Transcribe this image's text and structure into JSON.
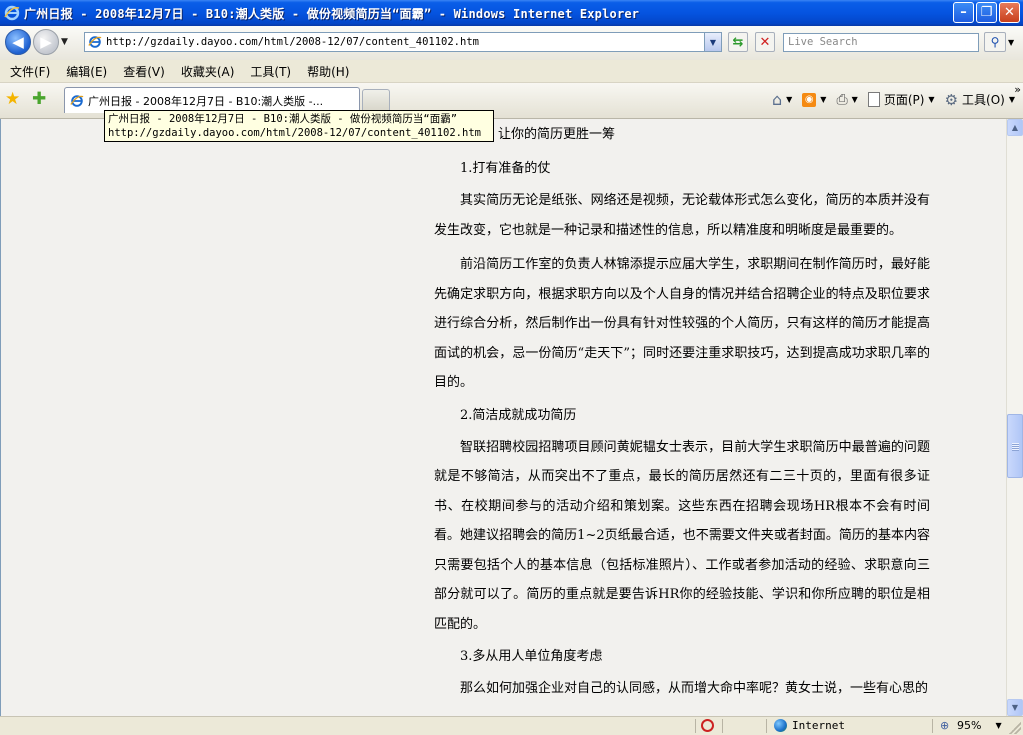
{
  "window": {
    "title": "广州日报 - 2008年12月7日 - B10:潮人类版 - 做份视频简历当“面霸” - Windows Internet Explorer"
  },
  "addressbar": {
    "url": "http://gzdaily.dayoo.com/html/2008-12/07/content_401102.htm",
    "search_placeholder": "Live Search"
  },
  "menu": {
    "items": [
      "文件(F)",
      "编辑(E)",
      "查看(V)",
      "收藏夹(A)",
      "工具(T)",
      "帮助(H)"
    ]
  },
  "tabs": {
    "active_label": "广州日报 - 2008年12月7日 - B10:潮人类版 -..."
  },
  "commandbar": {
    "page_label": "页面(P)",
    "tools_label": "工具(O)"
  },
  "tooltip": {
    "line1": "广州日报 - 2008年12月7日 - B10:潮人类版 - 做份视频简历当“面霸”",
    "line2": "http://gzdaily.dayoo.com/html/2008-12/07/content_401102.htm"
  },
  "article": {
    "intro": "让你的简历更胜一筹",
    "h1": "1.打有准备的仗",
    "p1": "其实简历无论是纸张、网络还是视频，无论载体形式怎么变化，简历的本质并没有发生改变，它也就是一种记录和描述性的信息，所以精准度和明晰度是最重要的。",
    "p2": "前沿简历工作室的负责人林锦添提示应届大学生，求职期间在制作简历时，最好能先确定求职方向，根据求职方向以及个人自身的情况并结合招聘企业的特点及职位要求进行综合分析，然后制作出一份具有针对性较强的个人简历，只有这样的简历才能提高面试的机会，忌一份简历“走天下”；同时还要注重求职技巧，达到提高成功求职几率的目的。",
    "h2": "2.简洁成就成功简历",
    "p3": "智联招聘校园招聘项目顾问黄妮韫女士表示，目前大学生求职简历中最普遍的问题就是不够简洁，从而突出不了重点，最长的简历居然还有二三十页的，里面有很多证书、在校期间参与的活动介绍和策划案。这些东西在招聘会现场HR根本不会有时间看。她建议招聘会的简历1~2页纸最合适，也不需要文件夹或者封面。简历的基本内容只需要包括个人的基本信息（包括标准照片）、工作或者参加活动的经验、求职意向三部分就可以了。简历的重点就是要告诉HR你的经验技能、学识和你所应聘的职位是相匹配的。",
    "h3": "3.多从用人单位角度考虑",
    "p4": "那么如何加强企业对自己的认同感，从而增大命中率呢？黄女士说，一些有心思的"
  },
  "status": {
    "zone": "Internet",
    "zoom": "95%"
  }
}
